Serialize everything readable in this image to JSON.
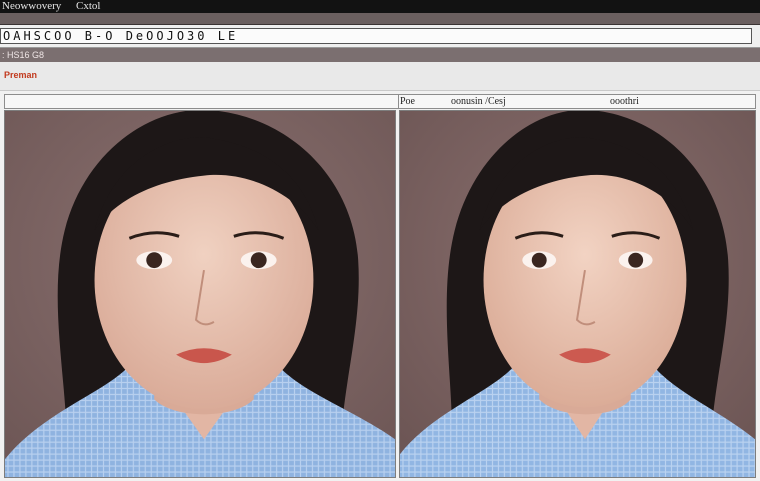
{
  "window": {
    "title": "Neowwovery",
    "subtitle": "Cxtol"
  },
  "address": {
    "value": "OAHSCOO B-O DeOOJO30 LE"
  },
  "meta": {
    "text": ": HS16 G8"
  },
  "menubar": {
    "brand": "Preman"
  },
  "viewer": {
    "left_header": "Poe",
    "middle_header": "oonusin /Cesj",
    "right_header": "ooothri"
  },
  "photos": [
    {
      "name": "left-photo",
      "subject": "portrait"
    },
    {
      "name": "right-photo",
      "subject": "portrait"
    }
  ],
  "colors": {
    "background": "#7f6665",
    "skin": "#e7c2b1",
    "hair": "#1d1717",
    "shirt": "#8fb3e0",
    "accent": "#c23a1e"
  }
}
